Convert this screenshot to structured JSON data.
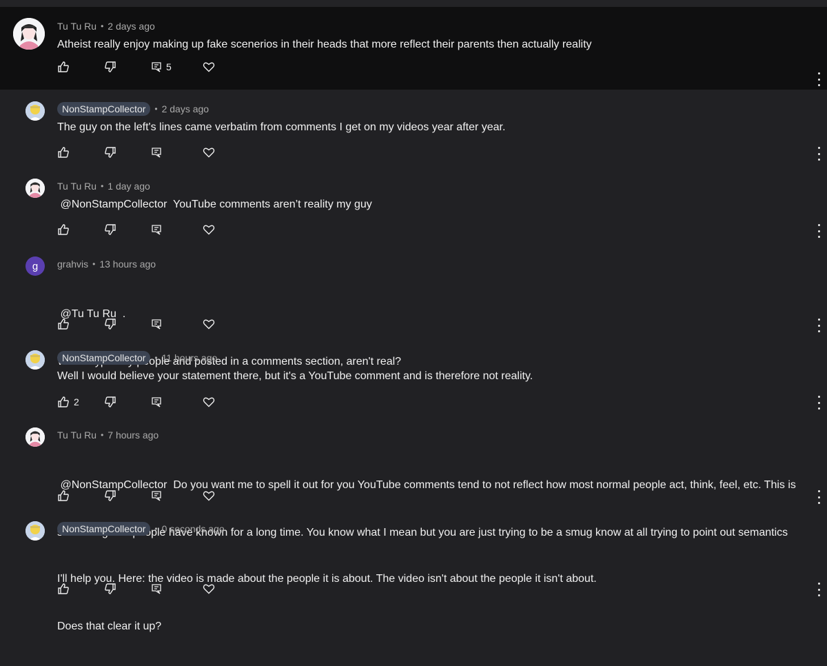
{
  "comments": [
    {
      "author": "Tu Tu Ru",
      "time": "2 days ago",
      "text": "Atheist really enjoy making up fake scenerios in their heads that more reflect their parents then actually reality",
      "likes": "",
      "replies": "5"
    },
    {
      "author": "NonStampCollector",
      "time": "2 days ago",
      "text": "The guy on the left's lines came verbatim from comments I get on my videos year after year.",
      "likes": ""
    },
    {
      "author": "Tu Tu Ru",
      "time": "1 day ago",
      "text": " @NonStampCollector  YouTube comments aren’t reality my guy",
      "likes": ""
    },
    {
      "author": "grahvis",
      "avatar_letter": "g",
      "time": "13 hours ago",
      "text_line1": " @Tu Tu Ru  .",
      "text_line2": "Words typed by people and posted in a comments section, aren't real?",
      "likes": ""
    },
    {
      "author": "NonStampCollector",
      "time": "11 hours ago",
      "text": "Well I would believe your statement there, but it's a YouTube comment and is therefore not reality.",
      "likes": "2"
    },
    {
      "author": "Tu Tu Ru",
      "time": "7 hours ago",
      "text_line1": " @NonStampCollector  Do you want me to spell it out for you YouTube comments tend to not reflect how most normal people act, think, feel, etc. This is",
      "text_line2": "something that people have known for a long time. You know what I mean but you are just trying to be a smug know at all trying to point out semantics",
      "likes": ""
    },
    {
      "author": "NonStampCollector",
      "time": "0 seconds ago",
      "text_line1": "I'll help you. Here: the video is made about the people it is about. The video isn't about the people it isn't about.",
      "text_line2": "Does that clear it up?",
      "likes": ""
    }
  ],
  "icons": {
    "like": "thumb-up-icon",
    "dislike": "thumb-down-icon",
    "reply": "reply-icon",
    "heart": "heart-icon",
    "more": "more-vert-icon"
  },
  "colors": {
    "background": "#212124",
    "top_comment_bg": "#0f0f10",
    "creator_badge": "#3c4453",
    "meta_text": "#aaaaaa"
  }
}
